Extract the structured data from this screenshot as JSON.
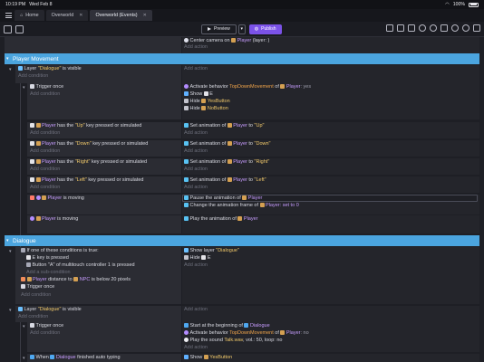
{
  "status": {
    "time": "10:19 PM",
    "date": "Wed Feb 8",
    "battery": "100%"
  },
  "tabs": [
    {
      "label": "Home"
    },
    {
      "label": "Overworld"
    },
    {
      "label": "Overworld (Events)"
    }
  ],
  "toolbar": {
    "preview_label": "Preview",
    "publish_label": "Publish"
  },
  "top": {
    "action": "Center camera on",
    "object": "Player",
    "rest": "(layer: )",
    "add_action": "Add action"
  },
  "groups": {
    "player_movement": "Player Movement",
    "dialogue": "Dialogue"
  },
  "common": {
    "add_condition": "Add condition",
    "add_action": "Add action",
    "add_subcondition": "Add a sub-condition"
  },
  "pm": {
    "layer_cond_pre": "Layer ",
    "layer_name": "\"Dialogue\"",
    "layer_cond_post": " is visible",
    "trigger_once": "Trigger once",
    "act_behavior_pre": "Activate behavior ",
    "act_behavior_name": "TopDownMovement",
    "act_of": " of ",
    "player": "Player",
    "act_yes": ": yes",
    "show": "Show",
    "show_obj": "E",
    "hide": "Hide",
    "yes_button": "YesButton",
    "no_button": "NoButton",
    "has_the": " has the ",
    "key_suffix": " key pressed or simulated",
    "set_anim_pre": "Set animation of ",
    "set_anim_to": " to ",
    "dirs": [
      "\"Up\"",
      "\"Down\"",
      "\"Right\"",
      "\"Left\""
    ],
    "is_moving": " is moving",
    "pause_pre": "Pause the animation of ",
    "change_frame_pre": "Change the animation frame of ",
    "set_to": ": set to ",
    "frame": "0",
    "play_pre": "Play the animation of "
  },
  "dlg": {
    "one_of": "If one of these conditions is true:",
    "e_key": "E key is pressed",
    "button_pre": "Button ",
    "button_name": "\"A\"",
    "button_post": " of multitouch controller ",
    "controller": "1",
    "button_end": " is pressed",
    "distance_pre": " distance to ",
    "npc": "NPC",
    "distance_post": " is below ",
    "distance": "20",
    "pixels": " pixels",
    "trigger_once": "Trigger once",
    "show_layer": "Show layer ",
    "dialogue_layer": "\"Dialogue\"",
    "hide": "Hide",
    "hide_obj": "E",
    "layer_pre": "Layer ",
    "layer_post": " is visible",
    "start_pre": "Start at the beginning of ",
    "dialogue_obj": "Dialogue",
    "act_behavior_pre": "Activate behavior ",
    "behavior": "TopDownMovement",
    "of": " of ",
    "player": "Player",
    "no": ": no",
    "sound_pre": "Play the sound ",
    "sound_file": "Talk.wav",
    "sound_rest": ", vol.: 50, loop: no",
    "when_pre": "When ",
    "when_post": " finished auto typing",
    "show": "Show",
    "yes_button": "YesButton"
  }
}
